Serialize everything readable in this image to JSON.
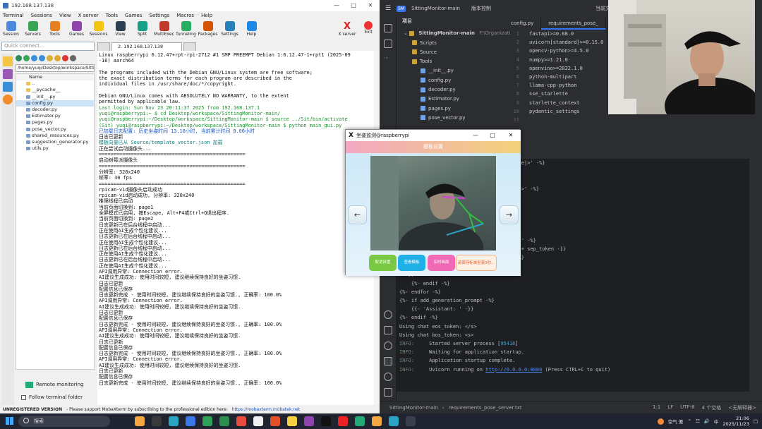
{
  "moba": {
    "title": "192.168.137.138",
    "menu": [
      "Terminal",
      "Sessions",
      "View",
      "X server",
      "Tools",
      "Games",
      "Settings",
      "Macros",
      "Help"
    ],
    "toolbar": [
      "Session",
      "Servers",
      "Tools",
      "Games",
      "Sessions",
      "View",
      "Split",
      "MultiExec",
      "Tunneling",
      "Packages",
      "Settings",
      "Help"
    ],
    "xserver": "X server",
    "exit": "Exit",
    "quick_connect": "Quick connect...",
    "path": "/home/yuqi/Desktop/workspace/Sittin",
    "tree_header": "Name",
    "tree": [
      {
        "n": "..",
        "d": true
      },
      {
        "n": "__pycache__",
        "d": true
      },
      {
        "n": "__init__.py"
      },
      {
        "n": "config.py",
        "sel": true
      },
      {
        "n": "decoder.py"
      },
      {
        "n": "Estimator.py"
      },
      {
        "n": "pages.py"
      },
      {
        "n": "pose_vector.py"
      },
      {
        "n": "shared_resources.py"
      },
      {
        "n": "suggestion_generator.py"
      },
      {
        "n": "utils.py"
      }
    ],
    "remote_monitoring": "Remote monitoring",
    "follow_terminal": "Follow terminal folder",
    "tab": "2. 192.168.137.138",
    "unreg_label": "UNREGISTERED VERSION",
    "unreg_text": "- Please support MobaXterm by subscribing to the professional edition here:",
    "unreg_link": "https://mobaxterm.mobatek.net"
  },
  "terminal": [
    {
      "t": "Linux raspberrypi 6.12.47+rpt-rpi-2712 #1 SMP PREEMPT Debian 1:6.12.47-1+rpt1 (2025-09",
      "c": ""
    },
    {
      "t": "-16) aarch64",
      "c": ""
    },
    {
      "t": "",
      "c": ""
    },
    {
      "t": "The programs included with the Debian GNU/Linux system are free software;",
      "c": ""
    },
    {
      "t": "the exact distribution terms for each program are described in the",
      "c": ""
    },
    {
      "t": "individual files in /usr/share/doc/*/copyright.",
      "c": ""
    },
    {
      "t": "",
      "c": ""
    },
    {
      "t": "Debian GNU/Linux comes with ABSOLUTELY NO WARRANTY, to the extent",
      "c": ""
    },
    {
      "t": "permitted by applicable law.",
      "c": ""
    },
    {
      "t": "Last login: Sun Nov 23 20:11:37 2025 from 192.168.137.1",
      "c": "c-green"
    },
    {
      "t": "yuqi@raspberrypi:~ $ cd Desktop/workspace/SittingMonitor-main/",
      "c": "c-green"
    },
    {
      "t": "yuqi@raspberrypi:~/Desktop/workspace/SittingMonitor-main $ source ../Sit/bin/activate",
      "c": "c-green"
    },
    {
      "t": "(Sit) yuqi@raspberrypi:~/Desktop/workspace/SittingMonitor-main $ python main_gui.py",
      "c": "c-green"
    },
    {
      "t": "已加载日志配置: 历史坐姿时间 13.10小时, 当前累计时间 0.00小时",
      "c": "c-blue"
    },
    {
      "t": "日志已更新",
      "c": ""
    },
    {
      "t": "模板向量已从 Source/template_vector.json 加载",
      "c": "c-teal"
    },
    {
      "t": "正在尝试启动摄像头...",
      "c": ""
    },
    {
      "t": "==================================================",
      "c": ""
    },
    {
      "t": "启动树莓派摄像头",
      "c": ""
    },
    {
      "t": "==================================================",
      "c": ""
    },
    {
      "t": "分辨率: 320x240",
      "c": ""
    },
    {
      "t": "帧率: 30 fps",
      "c": ""
    },
    {
      "t": "==================================================",
      "c": ""
    },
    {
      "t": "rpicam-vid摄像头启动成功",
      "c": ""
    },
    {
      "t": "rpicam-vid启动成功, 分辨率: 320x240",
      "c": ""
    },
    {
      "t": "推理线程已启动",
      "c": ""
    },
    {
      "t": "当前页面切换到: page1",
      "c": ""
    },
    {
      "t": "全屏模式已启用, 按Escape, Alt+F4或Ctrl+Q退出程序.",
      "c": ""
    },
    {
      "t": "当前页面切换到: page2",
      "c": ""
    },
    {
      "t": "日志更新已在后台线程中启动...",
      "c": ""
    },
    {
      "t": "正在使用AI生成个性化建议...",
      "c": ""
    },
    {
      "t": "日志更新已在后台线程中启动...",
      "c": ""
    },
    {
      "t": "正在使用AI生成个性化建议...",
      "c": ""
    },
    {
      "t": "日志更新已在后台线程中启动...",
      "c": ""
    },
    {
      "t": "正在使用AI生成个性化建议...",
      "c": ""
    },
    {
      "t": "日志更新已在后台线程中启动...",
      "c": ""
    },
    {
      "t": "正在使用AI生成个性化建议...",
      "c": ""
    },
    {
      "t": "API调用异常: Connection error.",
      "c": ""
    },
    {
      "t": "AI建议生成成功: 使用时间较短, 建议继续保持良好的坐姿习惯.",
      "c": ""
    },
    {
      "t": "日志已更新",
      "c": ""
    },
    {
      "t": "配置信息已保存",
      "c": ""
    },
    {
      "t": "日志更新完成 - 使用时间较短, 建议继续保持良好的坐姿习惯., 正确率: 100.0%",
      "c": ""
    },
    {
      "t": "API调用异常: Connection error.",
      "c": ""
    },
    {
      "t": "AI建议生成成功: 使用时间较短, 建议继续保持良好的坐姿习惯.",
      "c": ""
    },
    {
      "t": "日志已更新",
      "c": ""
    },
    {
      "t": "配置信息已保存",
      "c": ""
    },
    {
      "t": "日志更新完成 - 使用时间较短, 建议继续保持良好的坐姿习惯., 正确率: 100.0%",
      "c": ""
    },
    {
      "t": "API调用异常: Connection error.",
      "c": ""
    },
    {
      "t": "AI建议生成成功: 使用时间较短, 建议继续保持良好的坐姿习惯.",
      "c": ""
    },
    {
      "t": "日志已更新",
      "c": ""
    },
    {
      "t": "配置信息已保存",
      "c": ""
    },
    {
      "t": "日志更新完成 - 使用时间较短, 建议继续保持良好的坐姿习惯., 正确率: 100.0%",
      "c": ""
    },
    {
      "t": "API调用异常: Connection error.",
      "c": ""
    },
    {
      "t": "AI建议生成成功: 使用时间较短, 建议继续保持良好的坐姿习惯.",
      "c": ""
    },
    {
      "t": "日志已更新",
      "c": ""
    },
    {
      "t": "配置信息已保存",
      "c": ""
    },
    {
      "t": "日志更新完成 - 使用时间较短, 建议继续保持良好的坐姿习惯., 正确率: 100.0%",
      "c": ""
    },
    {
      "t": "",
      "c": ""
    }
  ],
  "ide": {
    "project_name": "SittingMonitor-main",
    "vcs": "版本控制",
    "current_file": "当前文件",
    "panel_title": "项目",
    "root": "SittingMonitor-main",
    "root_path": "F:\\Organizati",
    "tree": [
      {
        "n": "Scripts",
        "f": true,
        "lvl": 1
      },
      {
        "n": "Source",
        "f": true,
        "lvl": 1
      },
      {
        "n": "Tools",
        "f": true,
        "lvl": 1
      },
      {
        "n": "__init__.py",
        "lvl": 2
      },
      {
        "n": "config.py",
        "lvl": 2
      },
      {
        "n": "decoder.py",
        "lvl": 2
      },
      {
        "n": "Estimator.py",
        "lvl": 2
      },
      {
        "n": "pages.py",
        "lvl": 2
      },
      {
        "n": "pose_vector.py",
        "lvl": 2
      }
    ],
    "tabs": [
      "config.py",
      "requirements_pose_"
    ],
    "gutter": [
      "1",
      "2",
      "3",
      "4",
      "5",
      "6",
      "7",
      "8",
      "9",
      "10",
      "11"
    ],
    "code": [
      "fastapi>=0.68.0",
      "uvicorn[standard]>=0.15.0",
      "opencv-python>=4.5.0",
      "numpy>=1.21.0",
      "openvino>=2022.1.0",
      "python-multipart",
      "llama-cpp-python",
      "sse_starlette",
      "starlette_context",
      "pydantic_settings"
    ],
    "runlog": [
      {
        "t": "                                    ntence|>' -%}",
        "c": ""
      },
      {
        "t": "",
        "c": ""
      },
      {
        "t": "",
        "c": ""
      },
      {
        "t": "                                    ence|>' -%}",
        "c": ""
      },
      {
        "t": "",
        "c": ""
      },
      {
        "t": "",
        "c": ""
      },
      {
        "t": "                                    -%}",
        "c": ""
      },
      {
        "t": "                                    ] + '",
        "c": ""
      },
      {
        "t": "",
        "c": ""
      },
      {
        "t": "                                    stant' -%}",
        "c": ""
      },
      {
        "t": "                                    nt'] + sep_token -}}",
        "c": ""
      },
      {
        "t": "                                    n' -%}",
        "c": ""
      },
      {
        "t": "        {{- message['content'] + '",
        "c": ""
      },
      {
        "t": "' -}}",
        "c": ""
      },
      {
        "t": "    {%- endif -%}",
        "c": ""
      },
      {
        "t": "{%- endfor -%}",
        "c": ""
      },
      {
        "t": "{%- if add_generation_prompt -%}",
        "c": ""
      },
      {
        "t": "    {{- 'Assistant: ' -}}",
        "c": ""
      },
      {
        "t": "{%- endif -%}",
        "c": ""
      },
      {
        "t": "Using chat eos_token: </s>",
        "c": ""
      },
      {
        "t": "Using chat bos_token: <s>",
        "c": ""
      }
    ],
    "info": [
      {
        "lvl": "INFO:",
        "msg": "Started server process [",
        "num": "95416",
        "end": "]"
      },
      {
        "lvl": "INFO:",
        "msg": "Waiting for application startup.",
        "num": "",
        "end": ""
      },
      {
        "lvl": "INFO:",
        "msg": "Application startup complete.",
        "num": "",
        "end": ""
      },
      {
        "lvl": "INFO:",
        "msg": "Uvicorn running on ",
        "link": "http://0.0.0.0:8080",
        "end": " (Press CTRL+C to quit)"
      }
    ],
    "status_path": [
      "SittingMonitor-main",
      "requirements_pose_server.txt"
    ],
    "status_right": [
      "1:1",
      "LF",
      "UTF-8",
      "4 个空格",
      "<无解释器>"
    ]
  },
  "dialog": {
    "title": "坐姿监测@raspberrypi",
    "header": "模板设置",
    "prev": "←",
    "next": "→",
    "buttons": [
      {
        "label": "取消设置",
        "color": "#7ac943"
      },
      {
        "label": "查看模板",
        "color": "#1fb0e6"
      },
      {
        "label": "实时画面",
        "color": "#f06ab6"
      },
      {
        "label": "请保持标准坐姿3秒...",
        "color": "#fff0e4"
      }
    ]
  },
  "taskbar": {
    "search": "搜索",
    "weather": "空气 差",
    "ime": "中",
    "time": "21:06",
    "date": "2025/11/23"
  },
  "colors": {
    "moba_bg": "#f0f0f0",
    "ide_bg": "#2b2d30",
    "run_bg": "#1e1f22",
    "taskbar": "#1f2430",
    "accent": "#3574f0"
  }
}
